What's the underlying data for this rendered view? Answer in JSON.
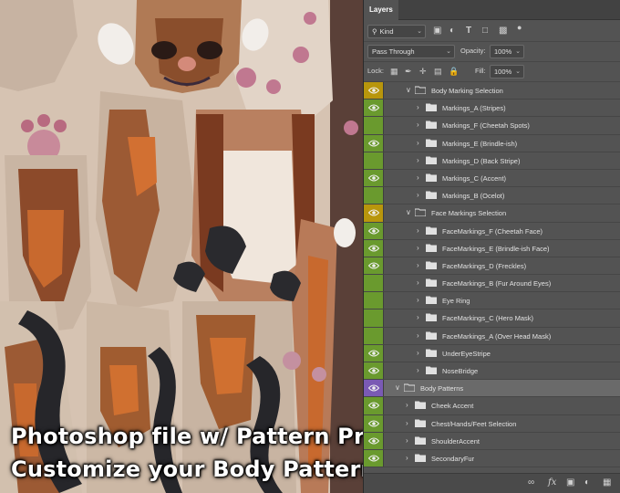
{
  "colors": {
    "green": "#6a9a2e",
    "yellow": "#b8960c",
    "purple": "#7a5ab4",
    "none": "#535353"
  },
  "panel": {
    "tab": "Layers",
    "filter": "Kind",
    "blend_mode": "Pass Through",
    "opacity_label": "Opacity:",
    "opacity_value": "100%",
    "lock_label": "Lock:",
    "fill_label": "Fill:",
    "fill_value": "100%"
  },
  "layers": [
    {
      "name": "Body Marking Selection",
      "color": "yellow",
      "eye": true,
      "group": true,
      "expanded": true,
      "indent": 1
    },
    {
      "name": "Markings_A (Stripes)",
      "color": "green",
      "eye": true,
      "group": true,
      "expanded": false,
      "indent": 2
    },
    {
      "name": "Markings_F (Cheetah Spots)",
      "color": "green",
      "eye": false,
      "group": true,
      "expanded": false,
      "indent": 2
    },
    {
      "name": "Markings_E (Brindle-ish)",
      "color": "green",
      "eye": true,
      "group": true,
      "expanded": false,
      "indent": 2
    },
    {
      "name": "Markings_D (Back Stripe)",
      "color": "green",
      "eye": false,
      "group": true,
      "expanded": false,
      "indent": 2
    },
    {
      "name": "Markings_C (Accent)",
      "color": "green",
      "eye": true,
      "group": true,
      "expanded": false,
      "indent": 2
    },
    {
      "name": "Markings_B (Ocelot)",
      "color": "green",
      "eye": false,
      "group": true,
      "expanded": false,
      "indent": 2
    },
    {
      "name": "Face Markings Selection",
      "color": "yellow",
      "eye": true,
      "group": true,
      "expanded": true,
      "indent": 1
    },
    {
      "name": "FaceMarkings_F (Cheetah Face)",
      "color": "green",
      "eye": true,
      "group": true,
      "expanded": false,
      "indent": 2
    },
    {
      "name": "FaceMarkings_E (Brindle-ish Face)",
      "color": "green",
      "eye": true,
      "group": true,
      "expanded": false,
      "indent": 2
    },
    {
      "name": "FaceMarkings_D (Freckles)",
      "color": "green",
      "eye": true,
      "group": true,
      "expanded": false,
      "indent": 2
    },
    {
      "name": "FaceMarkings_B (Fur Around Eyes)",
      "color": "green",
      "eye": false,
      "group": true,
      "expanded": false,
      "indent": 2
    },
    {
      "name": "Eye Ring",
      "color": "green",
      "eye": false,
      "group": true,
      "expanded": false,
      "indent": 2
    },
    {
      "name": "FaceMarkings_C (Hero Mask)",
      "color": "green",
      "eye": false,
      "group": true,
      "expanded": false,
      "indent": 2
    },
    {
      "name": "FaceMarkings_A (Over Head Mask)",
      "color": "green",
      "eye": false,
      "group": true,
      "expanded": false,
      "indent": 2
    },
    {
      "name": "UnderEyeStripe",
      "color": "green",
      "eye": true,
      "group": true,
      "expanded": false,
      "indent": 2
    },
    {
      "name": "NoseBridge",
      "color": "green",
      "eye": true,
      "group": true,
      "expanded": false,
      "indent": 2
    },
    {
      "name": "Body Patterns",
      "color": "purple",
      "eye": true,
      "group": true,
      "expanded": true,
      "indent": 0
    },
    {
      "name": "Cheek Accent",
      "color": "green",
      "eye": true,
      "group": true,
      "expanded": false,
      "indent": 1
    },
    {
      "name": "Chest/Hands/Feet Selection",
      "color": "green",
      "eye": true,
      "group": true,
      "expanded": false,
      "indent": 1
    },
    {
      "name": "ShoulderAccent",
      "color": "green",
      "eye": true,
      "group": true,
      "expanded": false,
      "indent": 1
    },
    {
      "name": "SecondaryFur",
      "color": "green",
      "eye": true,
      "group": true,
      "expanded": false,
      "indent": 1
    }
  ],
  "caption": {
    "line1": "Photoshop file w/ Pattern Presets",
    "line2": "Customize your Body Pattern & Color"
  }
}
